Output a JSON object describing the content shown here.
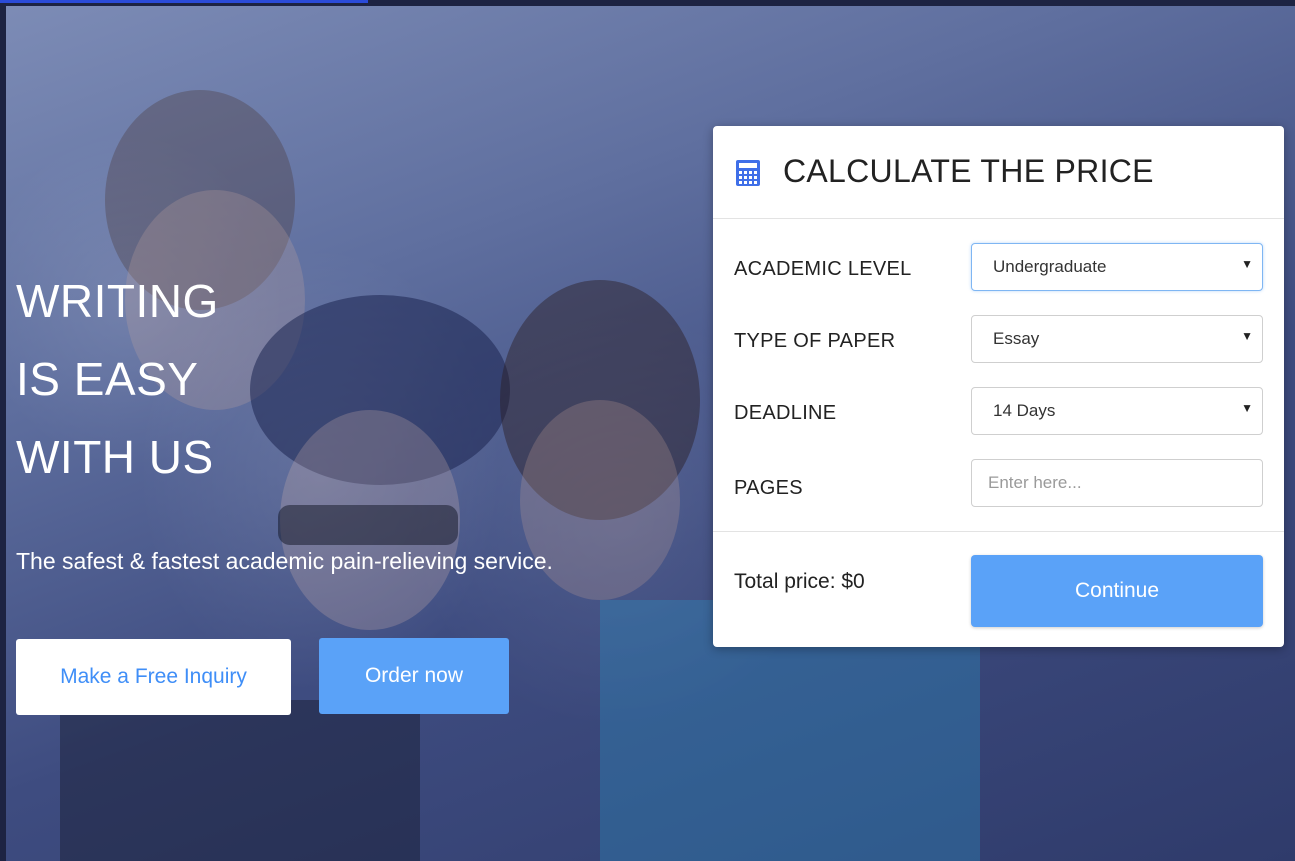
{
  "hero": {
    "title_lines": [
      "WRITING",
      "IS EASY",
      "WITH US"
    ],
    "subtitle": "The safest & fastest academic pain-relieving service.",
    "inquiry_button": "Make a Free Inquiry",
    "order_button": "Order now"
  },
  "calculator": {
    "title": "CALCULATE THE PRICE",
    "icon": "calculator-icon",
    "fields": [
      {
        "label": "ACADEMIC LEVEL",
        "value": "Undergraduate"
      },
      {
        "label": "TYPE OF PAPER",
        "value": "Essay"
      },
      {
        "label": "DEADLINE",
        "value": "14 Days"
      }
    ],
    "pages": {
      "label": "PAGES",
      "placeholder": "Enter here..."
    },
    "total_price": "Total price: $0",
    "continue_button": "Continue"
  },
  "colors": {
    "accent": "#5aa2f8",
    "link": "#3f8ef7",
    "overlay": "#3e4c80"
  }
}
